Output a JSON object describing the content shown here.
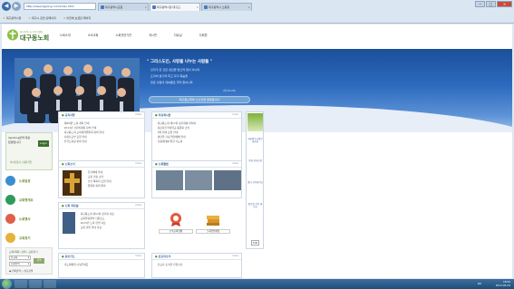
{
  "browser": {
    "url": "http://www.dgjlong.com/index.html",
    "tabs": [
      {
        "label": "대구광역시교원",
        "close": "×"
      },
      {
        "label": "대구광역시청 대구교",
        "close": "×"
      },
      {
        "label": "대구광역시 노동청",
        "close": "×"
      }
    ],
    "window_controls": {
      "minimize": "−",
      "maximize": "□",
      "close": "×"
    },
    "nav": {
      "back": "◀",
      "forward": "▶"
    },
    "bookmarks": [
      "대구광역시청",
      "대구시 관련 홈페이지",
      "이전에 보셨던 페이지"
    ]
  },
  "site": {
    "logo_sub": "대구광역시노동복지센터",
    "logo_main": "대구동노회",
    "gnb": [
      "노회소개",
      "소속교회",
      "노회관련기관",
      "게시판",
      "자료실",
      "다회원"
    ]
  },
  "banner": {
    "title": "\" 그리스도인, 사랑을 나누는 사람들 \"",
    "lines": [
      "인자가 온 것은 섬김을 받으려 함이 아니라",
      "도리어 섬기려 하고 자기 목숨을",
      "많은 사람의 대속물로 주려 함이니라"
    ],
    "ref": "(마 20:28)",
    "pill": "대구동노회에 오신것을 환영합니다"
  },
  "login": {
    "text": "dgnlong번역 대상",
    "text2": "환경입니다",
    "button": "Login",
    "links": "아이디찾기 | 회원가입"
  },
  "side_menu": [
    {
      "label": "노회일정",
      "icon": "calendar-icon",
      "color": "#3a8ed0"
    },
    {
      "label": "교회행게요",
      "icon": "globe-icon",
      "color": "#2f9a5a"
    },
    {
      "label": "노회행사",
      "icon": "flower-icon",
      "color": "#e0604a"
    },
    {
      "label": "교회찾기",
      "icon": "church-icon",
      "color": "#e5b23a"
    }
  ],
  "search": {
    "title": "교회(목회) 검색 / 교회찾기",
    "select1": "선교회",
    "select2": "시찰선택",
    "button": "검색",
    "radio1": "◉ 전화검색",
    "radio2": "○ 설교검색"
  },
  "panels": {
    "notice": {
      "title": "공지사항",
      "more": "more",
      "items": [
        "제8회원 노회 개최 안내",
        "2013년 신년하례회 참석 안내",
        "대구동노회 교회개척위원회 회의 안내",
        "사회선교부 모임 안내",
        "전국노회장 회의 안내"
      ]
    },
    "board": {
      "title": "자유게시판",
      "more": "more",
      "items": [
        "대구동노회 제17회 정기회를 마치며",
        "장로회신학대학교 동문회 소식",
        "9월 월례 모임 안내",
        "성탄절 기념 연합예배 안내",
        "다음세대를 위한 기도회"
      ]
    },
    "news": {
      "title": "노회소식",
      "more": "more",
      "items": [
        "헌신예배 안내",
        "교회 건축 소식",
        "신년 목회자 모임 안내",
        "임원회 회의 결과"
      ]
    },
    "gallery": {
      "title": "노회앨범",
      "more": "more"
    },
    "data": {
      "title": "노회 자료실",
      "more": "more",
      "items": [
        "대구동노회 제17회 정기회 자료",
        "교회행정양식 다운로드",
        "2013년 노회 헌법 자료",
        "교회 설립 안내 자료"
      ]
    },
    "facility": {
      "caption1": "소속교회현황",
      "caption2": "노회헌법개정"
    },
    "prayer": {
      "title": "중보기도",
      "more": "more",
      "items": [
        "기도제목을 나눠주세요"
      ]
    },
    "mission": {
      "title": "선교지소식",
      "more": "more",
      "items": [
        "선교지 소식을 전합니다"
      ]
    }
  },
  "quick_menu": [
    "대한예수교장로회총회",
    "총회 한국교회",
    "영남 신학대학교",
    "장로회 신학 대학교"
  ],
  "quick_top": "TOP",
  "taskbar": {
    "lang": "KO",
    "time": "18:52",
    "date": "2013-05-24"
  }
}
